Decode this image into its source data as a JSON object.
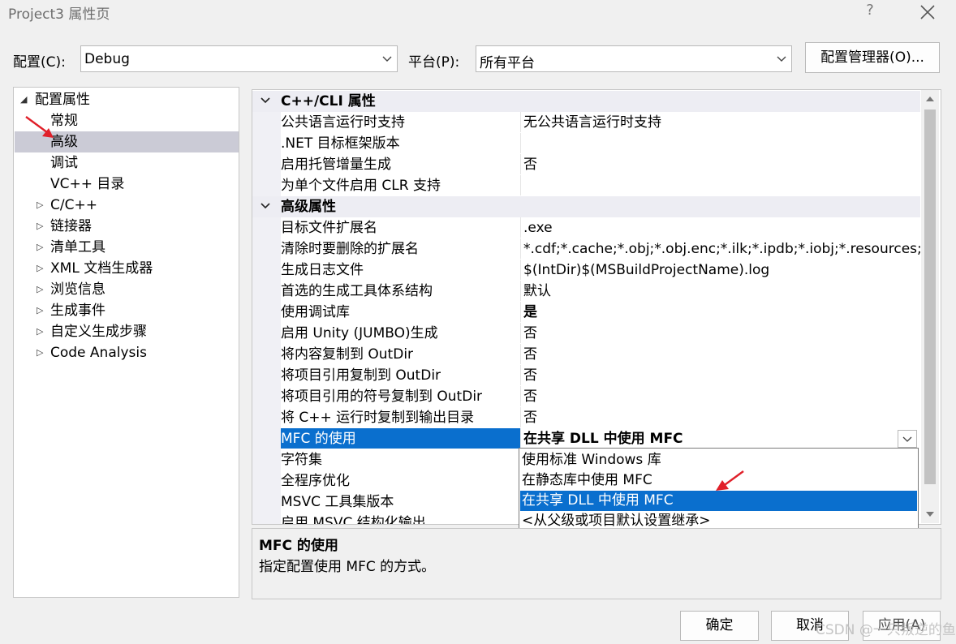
{
  "window": {
    "title": "Project3 属性页",
    "help": "?",
    "close_icon": "close-icon"
  },
  "config": {
    "config_label": "配置(C):",
    "config_value": "Debug",
    "platform_label": "平台(P):",
    "platform_value": "所有平台",
    "manager_button": "配置管理器(O)..."
  },
  "tree": {
    "root": "配置属性",
    "items": [
      {
        "label": "常规"
      },
      {
        "label": "高级"
      },
      {
        "label": "调试"
      },
      {
        "label": "VC++ 目录"
      },
      {
        "label": "C/C++"
      },
      {
        "label": "链接器"
      },
      {
        "label": "清单工具"
      },
      {
        "label": "XML 文档生成器"
      },
      {
        "label": "浏览信息"
      },
      {
        "label": "生成事件"
      },
      {
        "label": "自定义生成步骤"
      },
      {
        "label": "Code Analysis"
      }
    ]
  },
  "grid": {
    "categories": [
      {
        "label": "C++/CLI 属性",
        "rows": [
          {
            "name": "公共语言运行时支持",
            "value": "无公共语言运行时支持"
          },
          {
            "name": ".NET 目标框架版本",
            "value": ""
          },
          {
            "name": "启用托管增量生成",
            "value": "否"
          },
          {
            "name": "为单个文件启用 CLR 支持",
            "value": ""
          }
        ]
      },
      {
        "label": "高级属性",
        "rows": [
          {
            "name": "目标文件扩展名",
            "value": ".exe"
          },
          {
            "name": "清除时要删除的扩展名",
            "value": "*.cdf;*.cache;*.obj;*.obj.enc;*.ilk;*.ipdb;*.iobj;*.resources;*.t"
          },
          {
            "name": "生成日志文件",
            "value": "$(IntDir)$(MSBuildProjectName).log"
          },
          {
            "name": "首选的生成工具体系结构",
            "value": "默认"
          },
          {
            "name": "使用调试库",
            "value": "是"
          },
          {
            "name": "启用 Unity (JUMBO)生成",
            "value": "否"
          },
          {
            "name": "将内容复制到 OutDir",
            "value": "否"
          },
          {
            "name": "将项目引用复制到 OutDir",
            "value": "否"
          },
          {
            "name": "将项目引用的符号复制到 OutDir",
            "value": "否"
          },
          {
            "name": "将 C++ 运行时复制到输出目录",
            "value": "否"
          },
          {
            "name": "MFC 的使用",
            "value": "在共享 DLL 中使用 MFC"
          },
          {
            "name": "字符集",
            "value": ""
          },
          {
            "name": "全程序优化",
            "value": ""
          },
          {
            "name": "MSVC 工具集版本",
            "value": ""
          },
          {
            "name": "启用 MSVC 结构化输出",
            "value": ""
          }
        ]
      }
    ]
  },
  "dropdown": {
    "options": [
      "使用标准 Windows 库",
      "在静态库中使用 MFC",
      "在共享 DLL 中使用 MFC",
      "<从父级或项目默认设置继承>"
    ]
  },
  "description": {
    "title": "MFC 的使用",
    "text": "指定配置使用 MFC 的方式。"
  },
  "buttons": {
    "ok": "确定",
    "cancel": "取消",
    "apply": "应用(A)"
  },
  "watermark": "CSDN @一只叛逆的鱼",
  "colors": {
    "selection": "#0a6fce",
    "arrow": "#e0202a"
  }
}
